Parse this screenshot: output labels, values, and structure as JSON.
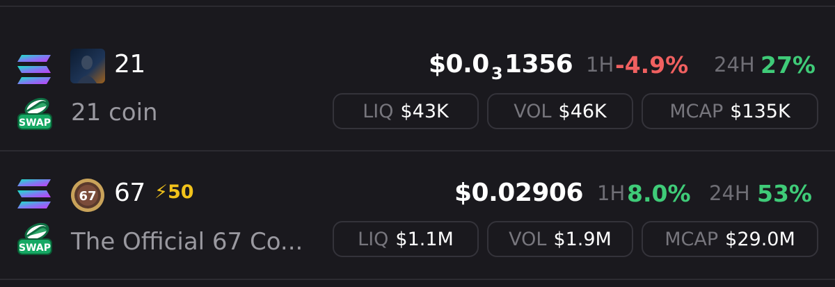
{
  "tokens": [
    {
      "ticker": "21",
      "name": "21 coin",
      "price_prefix": "$0.0",
      "price_sub": "3",
      "price_suffix": "1356",
      "h1_label": "1H",
      "h1_change": "-4.9%",
      "h24_label": "24H",
      "h24_change": "27%",
      "stats": [
        {
          "label": "LIQ",
          "value": "$43K"
        },
        {
          "label": "VOL",
          "value": "$46K"
        },
        {
          "label": "MCAP",
          "value": "$135K"
        }
      ]
    },
    {
      "ticker": "67",
      "boost": "50",
      "avatar_text": "67",
      "name": "The Official 67 Co...",
      "price": "$0.02906",
      "h1_label": "1H",
      "h1_change": "8.0%",
      "h24_label": "24H",
      "h24_change": "53%",
      "stats": [
        {
          "label": "LIQ",
          "value": "$1.1M"
        },
        {
          "label": "VOL",
          "value": "$1.9M"
        },
        {
          "label": "MCAP",
          "value": "$29.0M"
        }
      ]
    }
  ],
  "badges": {
    "swap_label": "SWAP"
  },
  "colors": {
    "negative": "#f06060",
    "positive": "#3fcb78",
    "boost": "#f1c21b",
    "background": "#1a191e"
  }
}
